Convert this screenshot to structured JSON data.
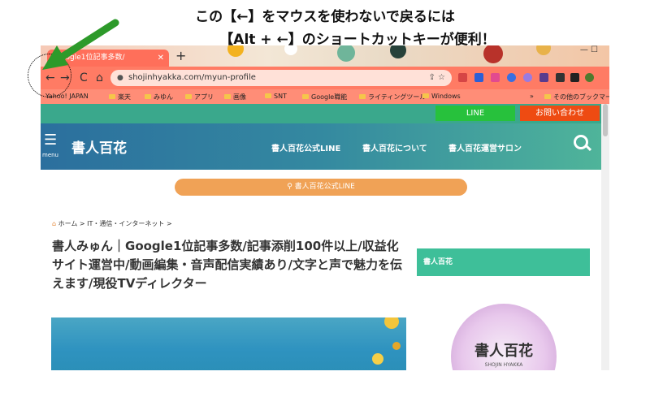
{
  "caption": {
    "line1": "この【←】をマウスを使わないで戻るには",
    "line2": "【Alt + ←】のショートカットキーが便利！"
  },
  "browser": {
    "tab_title": "Google1位記事多数/",
    "tab_close": "✕",
    "new_tab": "+",
    "window_controls": "—  ☐",
    "nav": {
      "back": "←",
      "forward": "→",
      "reload": "C",
      "home": "⌂"
    },
    "url": "shojinhyakka.com/myun-profile",
    "omnibox_icons": "⇪  ☆",
    "bookmarks": [
      {
        "label": "Yahoo! JAPAN"
      },
      {
        "label": "楽天"
      },
      {
        "label": "みゆん"
      },
      {
        "label": "アプリ"
      },
      {
        "label": "画像"
      },
      {
        "label": "SNT"
      },
      {
        "label": "Google職能"
      },
      {
        "label": "ライティングツール"
      },
      {
        "label": "Windows"
      }
    ],
    "other_bookmarks": "その他のブックマーク",
    "bookmark_more": "»"
  },
  "site": {
    "top_buttons": {
      "line": "LINE",
      "contact": "お問い合わせ"
    },
    "menu_label": "menu",
    "logo": "書人百花",
    "nav_items": [
      "書人百花公式LINE",
      "書人百花について",
      "書人百花運営サロン"
    ],
    "pill": "書人百花公式LINE",
    "breadcrumb": "ホーム >  IT・通信・インターネット >",
    "title": "書人みゅん｜Google1位記事多数/記事添削100件以上/収益化サイト運営中/動画編集・音声配信実績あり/文字と声で魅力を伝えます/現役TVディレクター",
    "sidebar_title": "書人百花",
    "badge_title": "書人百花",
    "badge_sub": "SHOJIN HYAKKA"
  },
  "colors": {
    "toolbar": "#ff7b64",
    "tab": "#ff6f5a",
    "line_button": "#27c13c",
    "contact_button": "#ee4b12",
    "pill": "#f0a256",
    "sidebar_box": "#3ebf99",
    "arrow": "#2d9a2a"
  },
  "icons": {
    "back": "back-arrow-icon",
    "forward": "forward-arrow-icon",
    "reload": "reload-icon",
    "home": "home-icon",
    "lock": "lock-icon",
    "search": "search-icon",
    "menu": "hamburger-menu-icon",
    "pin": "location-pin-icon",
    "annotation_arrow": "green-arrow-icon"
  }
}
